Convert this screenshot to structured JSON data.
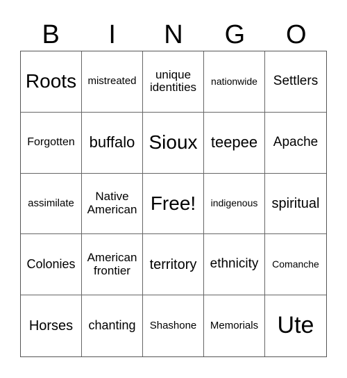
{
  "header": {
    "letters": [
      "B",
      "I",
      "N",
      "G",
      "O"
    ]
  },
  "cells": [
    "Roots",
    "mistreated",
    "unique identities",
    "nationwide",
    "Settlers",
    "Forgotten",
    "buffalo",
    "Sioux",
    "teepee",
    "Apache",
    "assimilate",
    "Native American",
    "Free!",
    "indigenous",
    "spiritual",
    "Colonies",
    "American frontier",
    "territory",
    "ethnicity",
    "Comanche",
    "Horses",
    "chanting",
    "Shashone",
    "Memorials",
    "Ute"
  ]
}
